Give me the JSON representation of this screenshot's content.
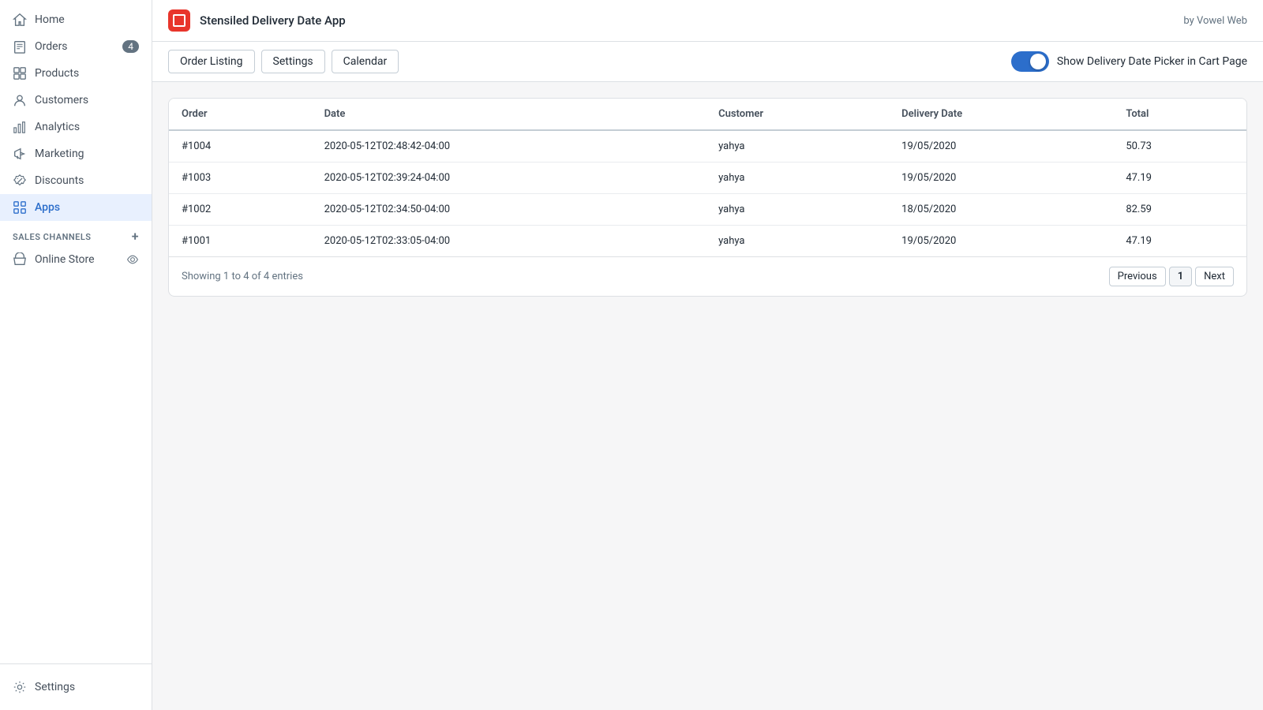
{
  "sidebar": {
    "items": [
      {
        "id": "home",
        "label": "Home",
        "icon": "home"
      },
      {
        "id": "orders",
        "label": "Orders",
        "icon": "orders",
        "badge": "4"
      },
      {
        "id": "products",
        "label": "Products",
        "icon": "products"
      },
      {
        "id": "customers",
        "label": "Customers",
        "icon": "customers"
      },
      {
        "id": "analytics",
        "label": "Analytics",
        "icon": "analytics"
      },
      {
        "id": "marketing",
        "label": "Marketing",
        "icon": "marketing"
      },
      {
        "id": "discounts",
        "label": "Discounts",
        "icon": "discounts"
      },
      {
        "id": "apps",
        "label": "Apps",
        "icon": "apps",
        "active": true
      }
    ],
    "sales_channels_label": "SALES CHANNELS",
    "online_store_label": "Online Store",
    "settings_label": "Settings"
  },
  "header": {
    "app_title": "Stensiled Delivery Date App",
    "by_label": "by Vowel Web"
  },
  "toolbar": {
    "btn_order_listing": "Order Listing",
    "btn_settings": "Settings",
    "btn_calendar": "Calendar",
    "toggle_label": "Show Delivery Date Picker in Cart Page"
  },
  "table": {
    "columns": [
      "Order",
      "Date",
      "Customer",
      "Delivery Date",
      "Total"
    ],
    "rows": [
      {
        "order": "#1004",
        "date": "2020-05-12T02:48:42-04:00",
        "customer": "yahya",
        "delivery_date": "19/05/2020",
        "total": "50.73"
      },
      {
        "order": "#1003",
        "date": "2020-05-12T02:39:24-04:00",
        "customer": "yahya",
        "delivery_date": "19/05/2020",
        "total": "47.19"
      },
      {
        "order": "#1002",
        "date": "2020-05-12T02:34:50-04:00",
        "customer": "yahya",
        "delivery_date": "18/05/2020",
        "total": "82.59"
      },
      {
        "order": "#1001",
        "date": "2020-05-12T02:33:05-04:00",
        "customer": "yahya",
        "delivery_date": "19/05/2020",
        "total": "47.19"
      }
    ],
    "showing_text": "Showing 1 to 4 of 4 entries"
  },
  "pagination": {
    "previous_label": "Previous",
    "next_label": "Next",
    "current_page": "1"
  }
}
